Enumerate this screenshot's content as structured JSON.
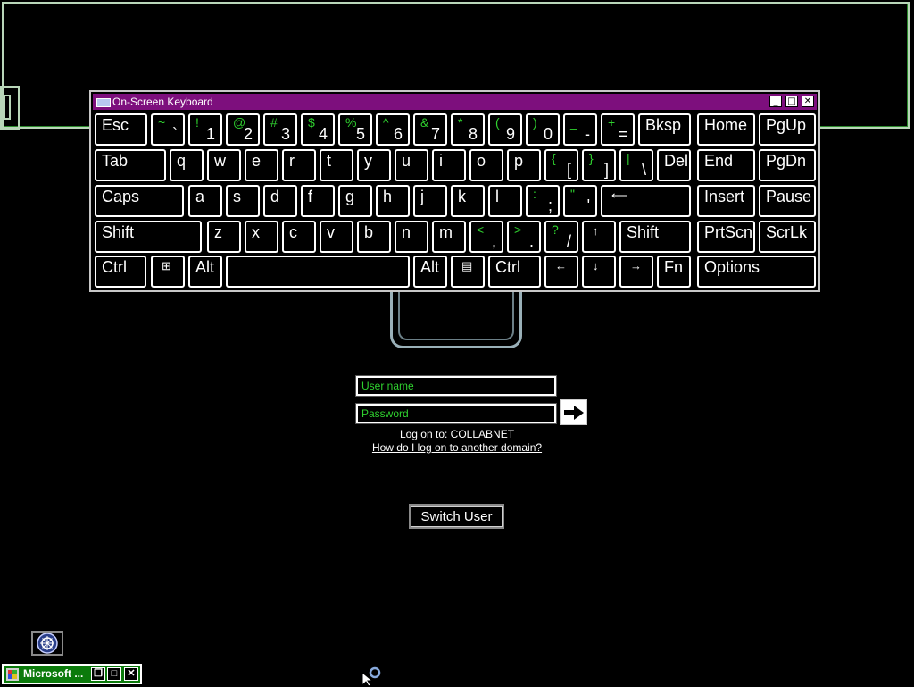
{
  "keyboard": {
    "title": "On-Screen Keyboard",
    "window_buttons": [
      "minimize",
      "maximize",
      "close"
    ],
    "rows": [
      [
        {
          "label": "Esc"
        },
        {
          "top": "~",
          "bottom": "`"
        },
        {
          "top": "!",
          "bottom": "1"
        },
        {
          "top": "@",
          "bottom": "2"
        },
        {
          "top": "#",
          "bottom": "3"
        },
        {
          "top": "$",
          "bottom": "4"
        },
        {
          "top": "%",
          "bottom": "5"
        },
        {
          "top": "^",
          "bottom": "6"
        },
        {
          "top": "&",
          "bottom": "7"
        },
        {
          "top": "*",
          "bottom": "8"
        },
        {
          "top": "(",
          "bottom": "9"
        },
        {
          "top": ")",
          "bottom": "0"
        },
        {
          "top": "_",
          "bottom": "-"
        },
        {
          "top": "+",
          "bottom": "="
        },
        {
          "label": "Bksp"
        },
        {
          "label": "Home"
        },
        {
          "label": "PgUp"
        }
      ],
      [
        {
          "label": "Tab"
        },
        {
          "label": "q"
        },
        {
          "label": "w"
        },
        {
          "label": "e"
        },
        {
          "label": "r"
        },
        {
          "label": "t"
        },
        {
          "label": "y"
        },
        {
          "label": "u"
        },
        {
          "label": "i"
        },
        {
          "label": "o"
        },
        {
          "label": "p"
        },
        {
          "top": "{",
          "bottom": "["
        },
        {
          "top": "}",
          "bottom": "]"
        },
        {
          "top": "|",
          "bottom": "\\"
        },
        {
          "label": "Del"
        },
        {
          "label": "End"
        },
        {
          "label": "PgDn"
        }
      ],
      [
        {
          "label": "Caps"
        },
        {
          "label": "a"
        },
        {
          "label": "s"
        },
        {
          "label": "d"
        },
        {
          "label": "f"
        },
        {
          "label": "g"
        },
        {
          "label": "h"
        },
        {
          "label": "j"
        },
        {
          "label": "k"
        },
        {
          "label": "l"
        },
        {
          "top": ":",
          "bottom": ";"
        },
        {
          "top": "\"",
          "bottom": "'"
        },
        {
          "label": "⟵"
        },
        {
          "label": "Insert"
        },
        {
          "label": "Pause"
        }
      ],
      [
        {
          "label": "Shift"
        },
        {
          "label": "z"
        },
        {
          "label": "x"
        },
        {
          "label": "c"
        },
        {
          "label": "v"
        },
        {
          "label": "b"
        },
        {
          "label": "n"
        },
        {
          "label": "m"
        },
        {
          "top": "<",
          "bottom": ","
        },
        {
          "top": ">",
          "bottom": "."
        },
        {
          "top": "?",
          "bottom": "/"
        },
        {
          "label": "↑"
        },
        {
          "label": "Shift"
        },
        {
          "label": "PrtScn"
        },
        {
          "label": "ScrLk"
        }
      ],
      [
        {
          "label": "Ctrl"
        },
        {
          "label": "⊞"
        },
        {
          "label": "Alt"
        },
        {
          "label": ""
        },
        {
          "label": "Alt"
        },
        {
          "label": "▤"
        },
        {
          "label": "Ctrl"
        },
        {
          "label": "←"
        },
        {
          "label": "↓"
        },
        {
          "label": "→"
        },
        {
          "label": "Fn"
        },
        {
          "label": "Options"
        }
      ]
    ]
  },
  "login": {
    "username_placeholder": "User name",
    "password_placeholder": "Password",
    "logon_to": "Log on to: COLLABNET",
    "other_domain_link": "How do I log on to another domain?",
    "submit_icon": "arrow-right-icon",
    "switch_user": "Switch User"
  },
  "taskbar": {
    "item_label": "Microsoft ...",
    "buttons": [
      "restore",
      "maximize",
      "close"
    ]
  },
  "colors": {
    "title_bar": "#7d0f7d",
    "accent_text": "#2fd12f",
    "taskbar": "#0b7a0b"
  }
}
